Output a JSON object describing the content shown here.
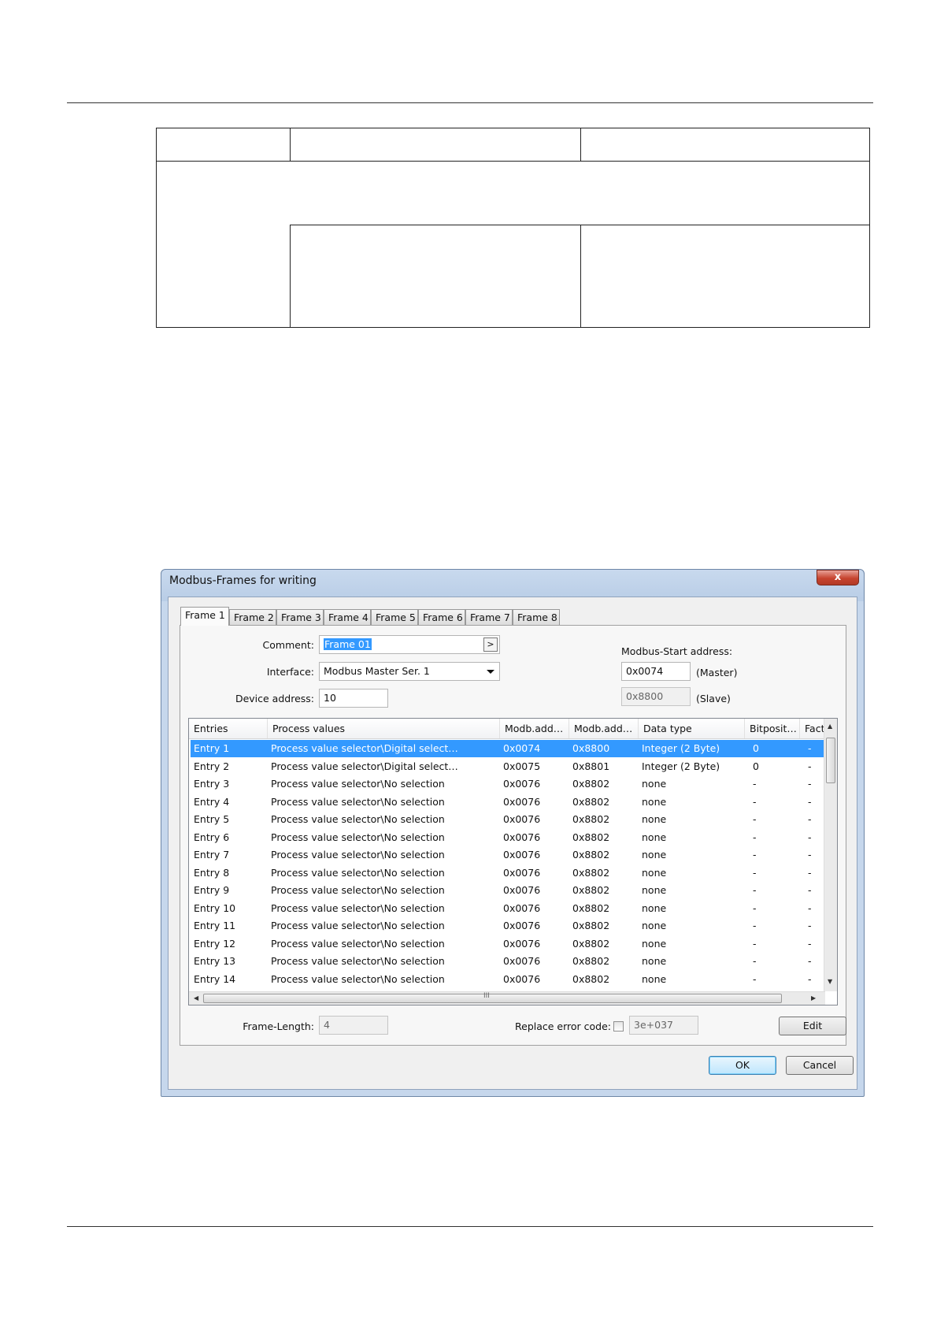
{
  "dialog": {
    "title": "Modbus-Frames for writing",
    "close_label": "x",
    "tabs": [
      "Frame 1",
      "Frame 2",
      "Frame 3",
      "Frame 4",
      "Frame 5",
      "Frame 6",
      "Frame 7",
      "Frame 8"
    ],
    "active_tab": 0,
    "comment": {
      "label": "Comment:",
      "value": "Frame 01",
      "button_label": ">"
    },
    "interface": {
      "label": "Interface:",
      "value": "Modbus Master Ser. 1"
    },
    "device_address": {
      "label": "Device address:",
      "value": "10"
    },
    "modbus_start": {
      "label": "Modbus-Start address:",
      "master_value": "0x0074",
      "master_label": "(Master)",
      "slave_value": "0x8800",
      "slave_label": "(Slave)"
    },
    "table": {
      "columns": [
        "Entries",
        "Process values",
        "Modb.add…",
        "Modb.add…",
        "Data type",
        "Bitposit…",
        "Facto"
      ],
      "rows": [
        [
          "Entry 1",
          "Process value selector\\Digital select…",
          "0x0074",
          "0x8800",
          "Integer (2 Byte)",
          "0",
          "-"
        ],
        [
          "Entry 2",
          "Process value selector\\Digital select…",
          "0x0075",
          "0x8801",
          "Integer (2 Byte)",
          "0",
          "-"
        ],
        [
          "Entry 3",
          "Process value selector\\No selection",
          "0x0076",
          "0x8802",
          "none",
          "-",
          "-"
        ],
        [
          "Entry 4",
          "Process value selector\\No selection",
          "0x0076",
          "0x8802",
          "none",
          "-",
          "-"
        ],
        [
          "Entry 5",
          "Process value selector\\No selection",
          "0x0076",
          "0x8802",
          "none",
          "-",
          "-"
        ],
        [
          "Entry 6",
          "Process value selector\\No selection",
          "0x0076",
          "0x8802",
          "none",
          "-",
          "-"
        ],
        [
          "Entry 7",
          "Process value selector\\No selection",
          "0x0076",
          "0x8802",
          "none",
          "-",
          "-"
        ],
        [
          "Entry 8",
          "Process value selector\\No selection",
          "0x0076",
          "0x8802",
          "none",
          "-",
          "-"
        ],
        [
          "Entry 9",
          "Process value selector\\No selection",
          "0x0076",
          "0x8802",
          "none",
          "-",
          "-"
        ],
        [
          "Entry 10",
          "Process value selector\\No selection",
          "0x0076",
          "0x8802",
          "none",
          "-",
          "-"
        ],
        [
          "Entry 11",
          "Process value selector\\No selection",
          "0x0076",
          "0x8802",
          "none",
          "-",
          "-"
        ],
        [
          "Entry 12",
          "Process value selector\\No selection",
          "0x0076",
          "0x8802",
          "none",
          "-",
          "-"
        ],
        [
          "Entry 13",
          "Process value selector\\No selection",
          "0x0076",
          "0x8802",
          "none",
          "-",
          "-"
        ],
        [
          "Entry 14",
          "Process value selector\\No selection",
          "0x0076",
          "0x8802",
          "none",
          "-",
          "-"
        ]
      ],
      "selected_row": 0,
      "scroll_grip": "III"
    },
    "frame_length": {
      "label": "Frame-Length:",
      "value": "4"
    },
    "replace_error_code": {
      "label": "Replace error code:",
      "checked": false,
      "value": "3e+037"
    },
    "buttons": {
      "edit": "Edit",
      "ok": "OK",
      "cancel": "Cancel"
    }
  }
}
